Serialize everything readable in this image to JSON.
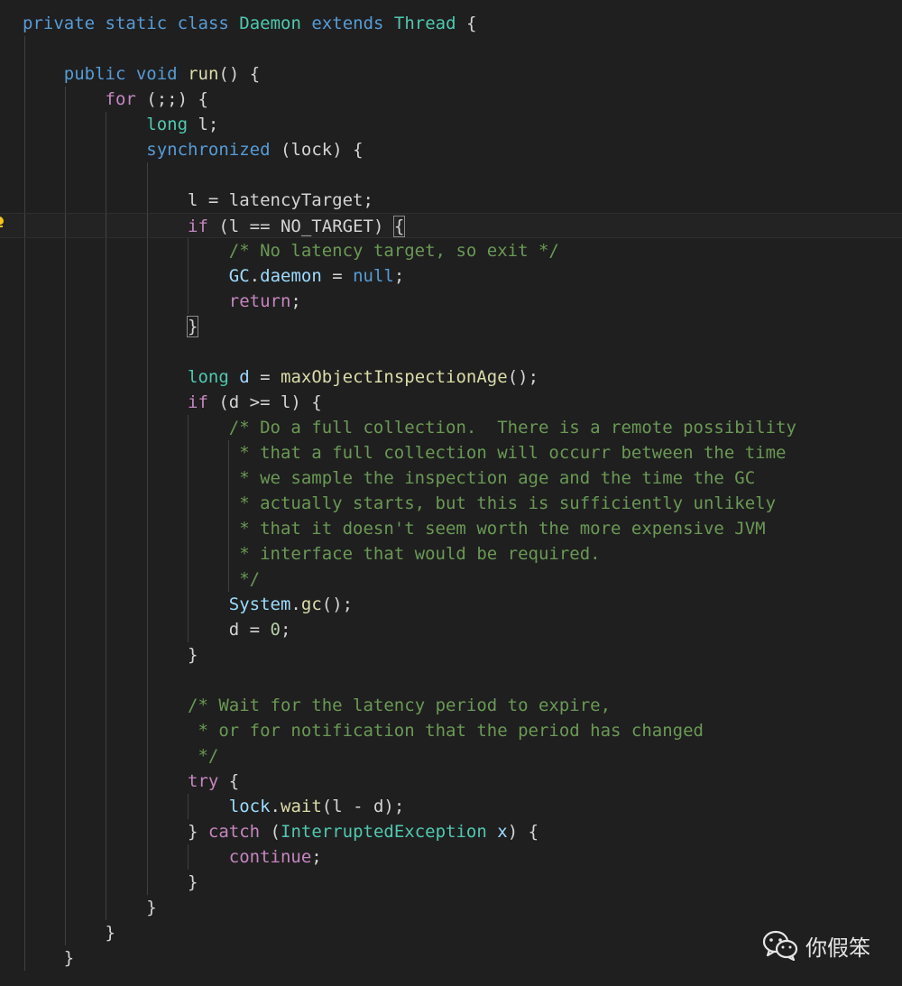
{
  "editor": {
    "language": "java",
    "theme_colors": {
      "background": "#1f1f1f",
      "keyword": "#569cd6",
      "control": "#c586c0",
      "type": "#4ec9b0",
      "function": "#dcdcaa",
      "variable": "#9cdcfe",
      "number": "#b5cea8",
      "comment": "#6a9955",
      "text": "#d4d4d4"
    },
    "current_line": 8,
    "lightbulb_icon": "lightbulb-icon",
    "lines": [
      [
        {
          "t": "private",
          "c": "keyword"
        },
        {
          "t": " "
        },
        {
          "t": "static",
          "c": "keyword"
        },
        {
          "t": " "
        },
        {
          "t": "class",
          "c": "keyword"
        },
        {
          "t": " "
        },
        {
          "t": "Daemon",
          "c": "type"
        },
        {
          "t": " "
        },
        {
          "t": "extends",
          "c": "keyword"
        },
        {
          "t": " "
        },
        {
          "t": "Thread",
          "c": "type"
        },
        {
          "t": " {"
        }
      ],
      [],
      [
        {
          "t": "    "
        },
        {
          "t": "public",
          "c": "keyword"
        },
        {
          "t": " "
        },
        {
          "t": "void",
          "c": "keyword"
        },
        {
          "t": " "
        },
        {
          "t": "run",
          "c": "function"
        },
        {
          "t": "() {"
        }
      ],
      [
        {
          "t": "        "
        },
        {
          "t": "for",
          "c": "control"
        },
        {
          "t": " (;;) {"
        }
      ],
      [
        {
          "t": "            "
        },
        {
          "t": "long",
          "c": "type"
        },
        {
          "t": " l;"
        }
      ],
      [
        {
          "t": "            "
        },
        {
          "t": "synchronized",
          "c": "keyword"
        },
        {
          "t": " (lock) {"
        }
      ],
      [],
      [
        {
          "t": "                l = latencyTarget;"
        }
      ],
      [
        {
          "t": "                "
        },
        {
          "t": "if",
          "c": "control"
        },
        {
          "t": " (l == NO_TARGET) "
        },
        {
          "t": "{",
          "c": "bracket"
        }
      ],
      [
        {
          "t": "                    "
        },
        {
          "t": "/* No latency target, so exit */",
          "c": "comment"
        }
      ],
      [
        {
          "t": "                    "
        },
        {
          "t": "GC",
          "c": "variable"
        },
        {
          "t": "."
        },
        {
          "t": "daemon",
          "c": "variable"
        },
        {
          "t": " = "
        },
        {
          "t": "null",
          "c": "keyword"
        },
        {
          "t": ";"
        }
      ],
      [
        {
          "t": "                    "
        },
        {
          "t": "return",
          "c": "control"
        },
        {
          "t": ";"
        }
      ],
      [
        {
          "t": "                "
        },
        {
          "t": "}",
          "c": "bracket"
        }
      ],
      [],
      [
        {
          "t": "                "
        },
        {
          "t": "long",
          "c": "type"
        },
        {
          "t": " "
        },
        {
          "t": "d",
          "c": "variable"
        },
        {
          "t": " = "
        },
        {
          "t": "maxObjectInspectionAge",
          "c": "function"
        },
        {
          "t": "();"
        }
      ],
      [
        {
          "t": "                "
        },
        {
          "t": "if",
          "c": "control"
        },
        {
          "t": " (d >= l) {"
        }
      ],
      [
        {
          "t": "                    "
        },
        {
          "t": "/* Do a full collection.  There is a remote possibility",
          "c": "comment"
        }
      ],
      [
        {
          "t": "                     "
        },
        {
          "t": "* that a full collection will occurr between the time",
          "c": "comment"
        }
      ],
      [
        {
          "t": "                     "
        },
        {
          "t": "* we sample the inspection age and the time the GC",
          "c": "comment"
        }
      ],
      [
        {
          "t": "                     "
        },
        {
          "t": "* actually starts, but this is sufficiently unlikely",
          "c": "comment"
        }
      ],
      [
        {
          "t": "                     "
        },
        {
          "t": "* that it doesn't seem worth the more expensive JVM",
          "c": "comment"
        }
      ],
      [
        {
          "t": "                     "
        },
        {
          "t": "* interface that would be required.",
          "c": "comment"
        }
      ],
      [
        {
          "t": "                     "
        },
        {
          "t": "*/",
          "c": "comment"
        }
      ],
      [
        {
          "t": "                    "
        },
        {
          "t": "System",
          "c": "variable"
        },
        {
          "t": "."
        },
        {
          "t": "gc",
          "c": "function"
        },
        {
          "t": "();"
        }
      ],
      [
        {
          "t": "                    d = "
        },
        {
          "t": "0",
          "c": "number"
        },
        {
          "t": ";"
        }
      ],
      [
        {
          "t": "                }"
        }
      ],
      [],
      [
        {
          "t": "                "
        },
        {
          "t": "/* Wait for the latency period to expire,",
          "c": "comment"
        }
      ],
      [
        {
          "t": "                 "
        },
        {
          "t": "* or for notification that the period has changed",
          "c": "comment"
        }
      ],
      [
        {
          "t": "                 "
        },
        {
          "t": "*/",
          "c": "comment"
        }
      ],
      [
        {
          "t": "                "
        },
        {
          "t": "try",
          "c": "control"
        },
        {
          "t": " {"
        }
      ],
      [
        {
          "t": "                    "
        },
        {
          "t": "lock",
          "c": "variable"
        },
        {
          "t": "."
        },
        {
          "t": "wait",
          "c": "function"
        },
        {
          "t": "(l - d);"
        }
      ],
      [
        {
          "t": "                } "
        },
        {
          "t": "catch",
          "c": "control"
        },
        {
          "t": " ("
        },
        {
          "t": "InterruptedException",
          "c": "type"
        },
        {
          "t": " "
        },
        {
          "t": "x",
          "c": "variable"
        },
        {
          "t": ") {"
        }
      ],
      [
        {
          "t": "                    "
        },
        {
          "t": "continue",
          "c": "control"
        },
        {
          "t": ";"
        }
      ],
      [
        {
          "t": "                }"
        }
      ],
      [
        {
          "t": "            }"
        }
      ],
      [
        {
          "t": "        }"
        }
      ],
      [
        {
          "t": "    }"
        }
      ]
    ]
  },
  "watermark": {
    "icon": "wechat-icon",
    "label": "你假笨"
  }
}
